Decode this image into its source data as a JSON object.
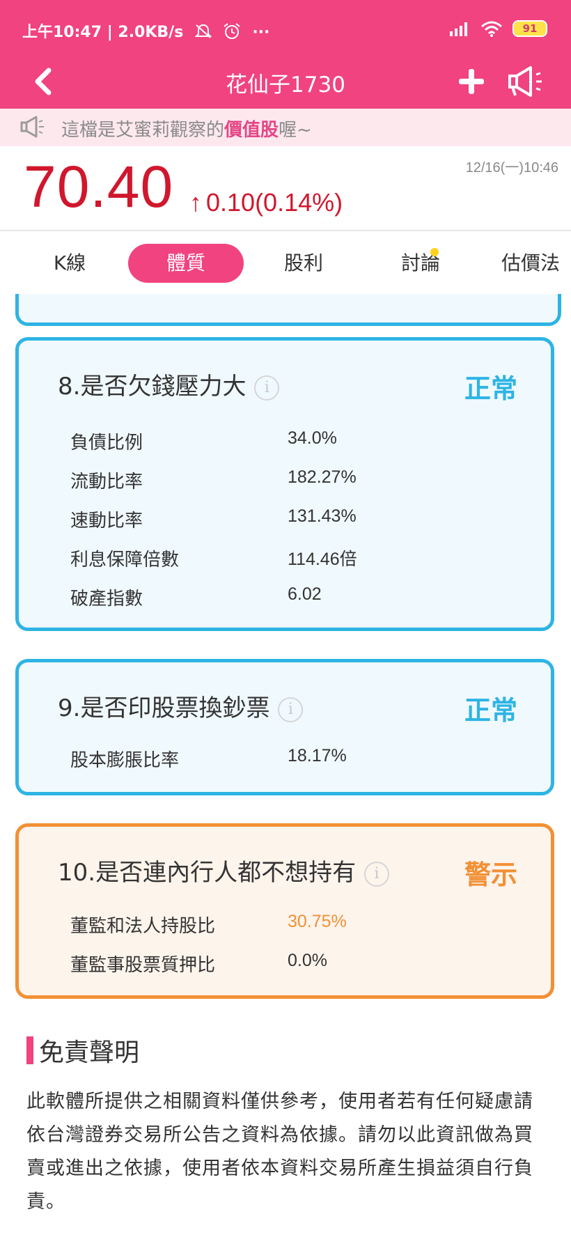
{
  "status_bar": {
    "left": "上午10:47 | 2.0KB/s",
    "extra": "···",
    "battery": "91"
  },
  "header": {
    "title": "花仙子1730"
  },
  "notice": {
    "prefix": "這檔是艾蜜莉觀察的",
    "highlight": "價值股",
    "suffix": "喔~"
  },
  "quote": {
    "price": "70.40",
    "arrow": "↑",
    "change": "0.10(0.14%)",
    "datetime": "12/16(一)10:46"
  },
  "tabs": [
    {
      "label": "K線"
    },
    {
      "label": "體質"
    },
    {
      "label": "股利"
    },
    {
      "label": "討論"
    },
    {
      "label": "估價法"
    }
  ],
  "cards": [
    {
      "title": "8.是否欠錢壓力大",
      "info": "i",
      "status": "正常",
      "rows": [
        {
          "label": "負債比例",
          "value": "34.0%"
        },
        {
          "label": "流動比率",
          "value": "182.27%"
        },
        {
          "label": "速動比率",
          "value": "131.43%"
        },
        {
          "label": "利息保障倍數",
          "value": "114.46倍"
        },
        {
          "label": "破產指數",
          "value": "6.02"
        }
      ]
    },
    {
      "title": "9.是否印股票換鈔票",
      "info": "i",
      "status": "正常",
      "rows": [
        {
          "label": "股本膨脹比率",
          "value": "18.17%"
        }
      ]
    },
    {
      "title": "10.是否連內行人都不想持有",
      "info": "i",
      "status": "警示",
      "rows": [
        {
          "label": "董監和法人持股比",
          "value": "30.75%"
        },
        {
          "label": "董監事股票質押比",
          "value": "0.0%"
        }
      ]
    }
  ],
  "disclaimer": {
    "title": "免責聲明",
    "body": "此軟體所提供之相關資料僅供參考，使用者若有任何疑慮請依台灣證券交易所公告之資料為依據。請勿以此資訊做為買賣或進出之依據，使用者依本資料交易所產生損益須自行負責。"
  },
  "colors": {
    "brand_pink": "#f0437f",
    "price_red": "#d0172d",
    "normal_blue": "#2eb4e4",
    "warn_orange": "#f29035"
  },
  "icons": [
    "back-chevron-icon",
    "plus-icon",
    "megaphone-icon",
    "info-icon",
    "wifi-icon",
    "signal-icon",
    "alarm-icon",
    "bell-off-icon"
  ]
}
